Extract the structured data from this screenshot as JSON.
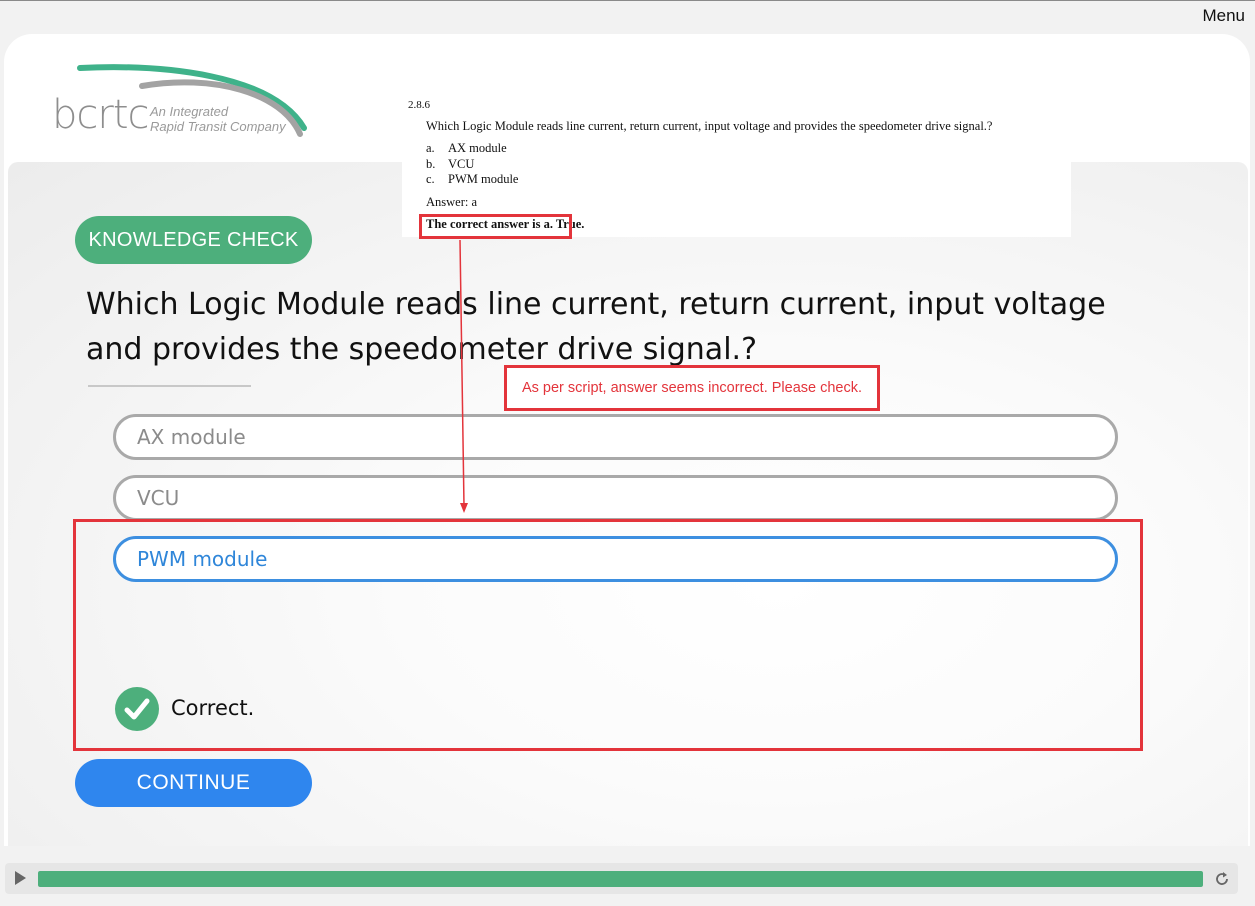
{
  "header": {
    "menu_label": "Menu"
  },
  "logo": {
    "wordmark": "bcrtc",
    "tagline_line1": "An Integrated",
    "tagline_line2": "Rapid Transit Company"
  },
  "script_excerpt": {
    "number": "2.8.6",
    "question": "Which Logic Module reads line current, return current, input voltage and provides the speedometer drive signal.?",
    "options": [
      {
        "letter": "a.",
        "text": "AX module"
      },
      {
        "letter": "b.",
        "text": "VCU"
      },
      {
        "letter": "c.",
        "text": "PWM module"
      }
    ],
    "answer": "Answer: a",
    "correct_statement": "The correct answer is a. True."
  },
  "quiz": {
    "badge": "KNOWLEDGE CHECK",
    "question": "Which Logic Module reads line current, return current, input voltage and provides the speedometer drive signal.?",
    "options": [
      "AX module",
      "VCU",
      "PWM module"
    ],
    "selected_index": 2,
    "feedback": "Correct.",
    "continue_label": "CONTINUE"
  },
  "review": {
    "note": "As per script, answer seems incorrect. Please check.",
    "color": "#e3343b"
  },
  "player": {
    "progress": 1.0,
    "accent": "#4daf7c",
    "icons": [
      "play-icon",
      "replay-icon"
    ]
  },
  "colors": {
    "green": "#4daf7c",
    "blue": "#2f86ee",
    "option_border": "#a9a9a9",
    "selected_border": "#3d8fe0"
  }
}
